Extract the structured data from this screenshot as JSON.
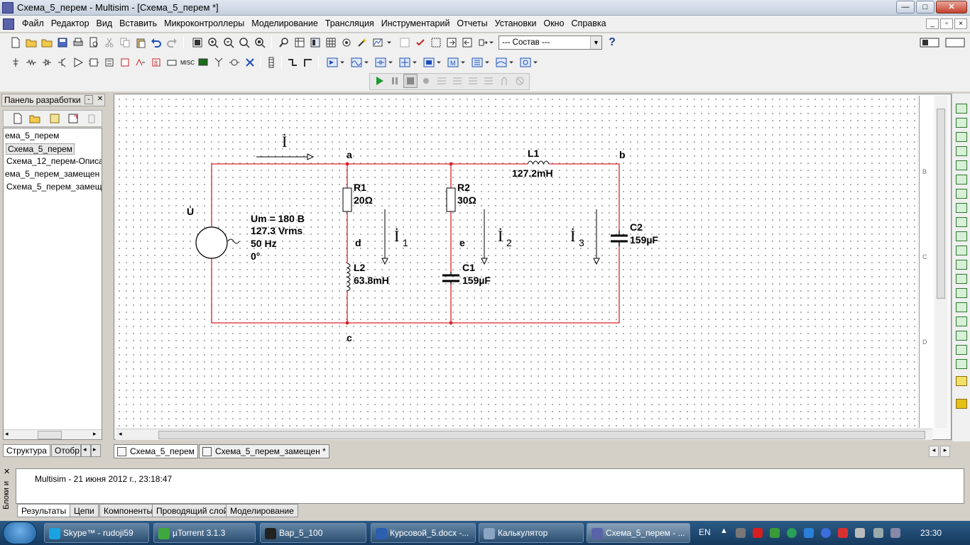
{
  "window": {
    "title": "Схема_5_перем - Multisim - [Схема_5_перем *]",
    "buttons": [
      "—",
      "□",
      "✕"
    ]
  },
  "menu": {
    "items": [
      "Файл",
      "Редактор",
      "Вид",
      "Вставить",
      "Микроконтроллеры",
      "Моделирование",
      "Трансляция",
      "Инструментарий",
      "Отчеты",
      "Установки",
      "Окно",
      "Справка"
    ]
  },
  "toolbar": {
    "combo_value": "--- Состав ---",
    "help_label": "?"
  },
  "left_panel": {
    "title": "Панель разработки",
    "items": [
      "ема_5_перем",
      "Схема_5_перем",
      "Схема_12_перем-Описа",
      "ема_5_перем_замещен",
      "Схема_5_перем_замеще"
    ],
    "tabs": [
      "Структура",
      "Отобр"
    ]
  },
  "ruler": [
    "B",
    "C",
    "D"
  ],
  "schematic": {
    "current_main": "İ",
    "node_a": "a",
    "node_b": "b",
    "node_c": "c",
    "node_d": "d",
    "node_e": "e",
    "voltage_symbol": "U̇",
    "source": {
      "line1": "Um = 180 B",
      "line2": "127.3 Vrms",
      "line3": "50 Hz",
      "line4": "0°"
    },
    "R1": {
      "name": "R1",
      "value": "20Ω"
    },
    "R2": {
      "name": "R2",
      "value": "30Ω"
    },
    "L1": {
      "name": "L1",
      "value": "127.2mH"
    },
    "L2": {
      "name": "L2",
      "value": "63.8mH"
    },
    "C1": {
      "name": "C1",
      "value": "159µF"
    },
    "C2": {
      "name": "C2",
      "value": "159µF"
    },
    "I1": "İ",
    "I1_sub": "1",
    "I2": "İ",
    "I2_sub": "2",
    "I3": "İ",
    "I3_sub": "3",
    "wire_color": "#d9252a"
  },
  "canvas_tabs": [
    "Схема_5_перем",
    "Схема_5_перем_замещен *"
  ],
  "results": {
    "side_title": "Блоки и",
    "message": "Multisim  -  21 июня 2012 г., 23:18:47",
    "tabs": [
      "Результаты",
      "Цепи",
      "Компоненты",
      "Проводящий слой",
      "Моделирование"
    ]
  },
  "taskbar": {
    "tasks": [
      {
        "label": "Skype™ - rudoji59",
        "icon_color": "#1aa3e0"
      },
      {
        "label": "µTorrent 3.1.3",
        "icon_color": "#3ea83e"
      },
      {
        "label": "Bap_5_100",
        "icon_color": "#222222"
      },
      {
        "label": "Курсовой_5.docx -...",
        "icon_color": "#2b5fb0"
      },
      {
        "label": "Калькулятор",
        "icon_color": "#8aa4c4"
      },
      {
        "label": "Схема_5_перем - ...",
        "icon_color": "#5a62a8"
      }
    ],
    "lang": "EN",
    "clock": "23:30"
  }
}
